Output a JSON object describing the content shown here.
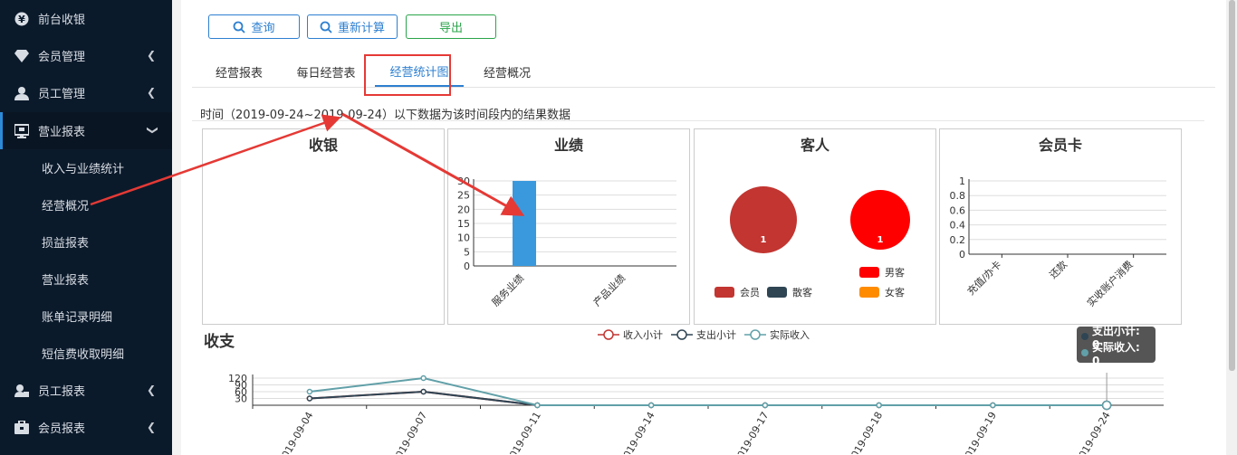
{
  "sidebar": {
    "items": [
      {
        "label": "前台收银",
        "icon": "yen-icon",
        "has_chevron": false
      },
      {
        "label": "会员管理",
        "icon": "diamond-icon",
        "has_chevron": true
      },
      {
        "label": "员工管理",
        "icon": "user-icon",
        "has_chevron": true
      },
      {
        "label": "营业报表",
        "icon": "monitor-icon",
        "has_chevron": true,
        "expanded": true
      },
      {
        "label": "员工报表",
        "icon": "user-card-icon",
        "has_chevron": true
      },
      {
        "label": "会员报表",
        "icon": "briefcase-icon",
        "has_chevron": true
      }
    ],
    "subitems": [
      "收入与业绩统计",
      "经营概况",
      "损益报表",
      "营业报表",
      "账单记录明细",
      "短信费收取明细"
    ]
  },
  "toolbar": {
    "query_label": "查询",
    "recalc_label": "重新计算",
    "export_label": "导出"
  },
  "tabs": [
    {
      "label": "经营报表",
      "active": false
    },
    {
      "label": "每日经营表",
      "active": false
    },
    {
      "label": "经营统计图",
      "active": true
    },
    {
      "label": "经营概况",
      "active": false
    }
  ],
  "date_text": "时间（2019-09-24~2019-09-24）以下数据为该时间段内的结果数据",
  "colors": {
    "accent": "#2d7fd0",
    "export_green": "#2aa44a",
    "annotation_red": "#e53935",
    "sidebar_bg": "#0b1a2b"
  },
  "panels": {
    "cash": {
      "title": "收银"
    },
    "performance": {
      "title": "业绩"
    },
    "guests": {
      "title": "客人"
    },
    "card": {
      "title": "会员卡"
    }
  },
  "income_title": "收支",
  "tooltip": {
    "line1": "支出小计: 0",
    "line2": "实际收入: 0"
  },
  "chart_data": [
    {
      "type": "bar",
      "title": "业绩",
      "categories": [
        "服务业绩",
        "产品业绩"
      ],
      "series": [
        {
          "values": [
            30,
            0
          ]
        }
      ],
      "ylim": [
        0,
        30
      ],
      "yticks": [
        0,
        5,
        10,
        15,
        20,
        25,
        30
      ],
      "color": "#3a99dd",
      "grid": true
    },
    {
      "type": "pie",
      "title": "客人",
      "pies": [
        {
          "slices": [
            {
              "name": "会员",
              "value": 1,
              "color": "#c23531"
            },
            {
              "name": "散客",
              "value": 0,
              "color": "#2f4554"
            }
          ],
          "label": "1"
        },
        {
          "slices": [
            {
              "name": "男客",
              "value": 1,
              "color": "#ff0000"
            },
            {
              "name": "女客",
              "value": 0,
              "color": "#ff8c00"
            }
          ],
          "label": "1"
        }
      ],
      "legend": [
        {
          "name": "会员",
          "color": "#c23531"
        },
        {
          "name": "散客",
          "color": "#2f4554"
        },
        {
          "name": "男客",
          "color": "#ff0000"
        },
        {
          "name": "女客",
          "color": "#ff8c00"
        }
      ]
    },
    {
      "type": "bar",
      "title": "会员卡",
      "categories": [
        "充值/办卡",
        "还款",
        "实收账户消费"
      ],
      "series": [
        {
          "values": [
            0,
            0,
            0
          ]
        }
      ],
      "ylim": [
        0,
        1
      ],
      "yticks": [
        "0",
        "0.2",
        "0.4",
        "0.6",
        "0.8",
        "1"
      ],
      "grid": true
    },
    {
      "type": "line",
      "title": "收支",
      "categories": [
        "2019-09-04",
        "2019-09-07",
        "2019-09-11",
        "2019-09-14",
        "2019-09-17",
        "2019-09-18",
        "2019-09-19",
        "2019-09-24"
      ],
      "series": [
        {
          "name": "收入小计",
          "values": [
            30,
            60,
            0,
            0,
            0,
            0,
            0,
            0
          ],
          "color": "#c23531"
        },
        {
          "name": "支出小计",
          "values": [
            30,
            60,
            0,
            0,
            0,
            0,
            0,
            0
          ],
          "color": "#2f4554"
        },
        {
          "name": "实际收入",
          "values": [
            60,
            120,
            0,
            0,
            0,
            0,
            0,
            0
          ],
          "color": "#61a0a8"
        }
      ],
      "ylim": [
        0,
        120
      ],
      "yticks": [
        "30",
        "60",
        "90",
        "120"
      ],
      "legend_position": "top-center",
      "grid": true
    }
  ]
}
